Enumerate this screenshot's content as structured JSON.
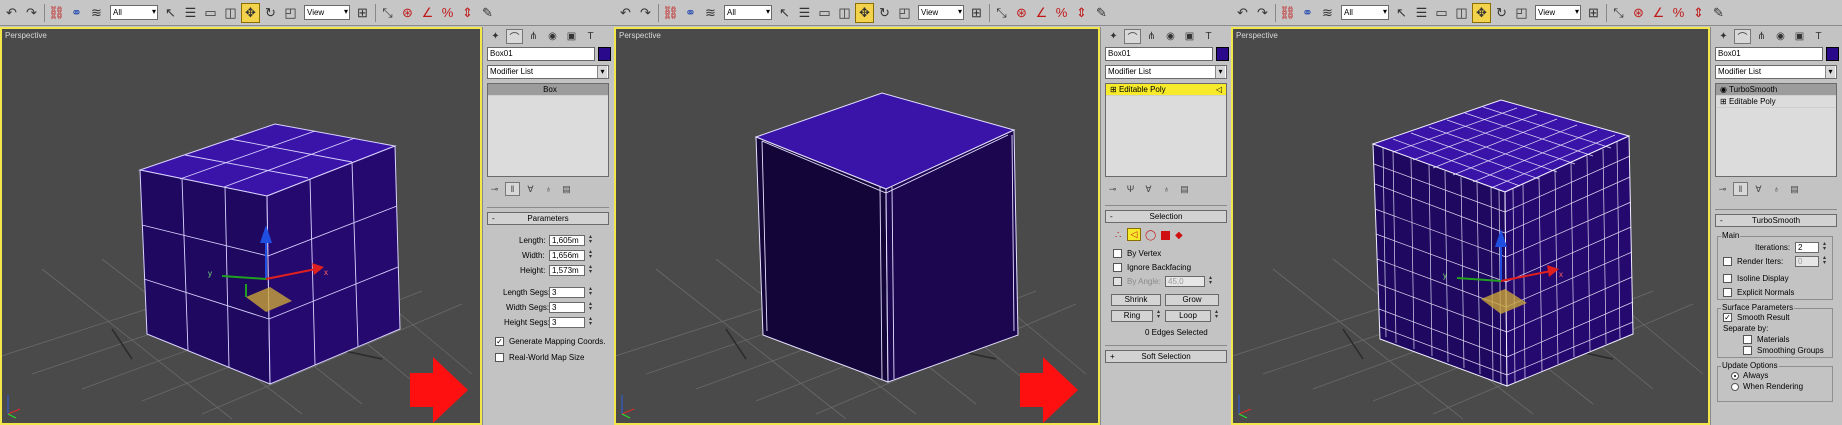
{
  "colors": {
    "viewport_border": "#f2e64a",
    "object_fill": "#2a0a8a",
    "arrow": "#ff1010",
    "stack_highlight": "#f6ea2a"
  },
  "panel1": {
    "viewport_label": "Perspective",
    "toolbar": {
      "selection_filter": "All",
      "coord_system": "View"
    },
    "object_name": "Box01",
    "modifier_list": "Modifier List",
    "stack": [
      "Box"
    ],
    "parameters": {
      "title": "Parameters",
      "length_label": "Length:",
      "length": "1,605m",
      "width_label": "Width:",
      "width": "1,656m",
      "height_label": "Height:",
      "height": "1,573m",
      "length_segs_label": "Length Segs:",
      "length_segs": "3",
      "width_segs_label": "Width Segs:",
      "width_segs": "3",
      "height_segs_label": "Height Segs:",
      "height_segs": "3",
      "gen_mapping": "Generate Mapping Coords.",
      "real_world": "Real-World Map Size"
    },
    "gizmo": {
      "x": "x",
      "y": "y"
    }
  },
  "panel2": {
    "viewport_label": "Perspective",
    "toolbar": {
      "selection_filter": "All",
      "coord_system": "View"
    },
    "object_name": "Box01",
    "modifier_list": "Modifier List",
    "stack": [
      "Editable Poly"
    ],
    "selection": {
      "title": "Selection",
      "by_vertex": "By Vertex",
      "ignore_backfacing": "Ignore Backfacing",
      "by_angle": "By Angle:",
      "angle_value": "45,0",
      "shrink": "Shrink",
      "grow": "Grow",
      "ring": "Ring",
      "loop": "Loop",
      "status": "0 Edges Selected"
    },
    "soft_selection": "Soft Selection"
  },
  "panel3": {
    "viewport_label": "Perspective",
    "toolbar": {
      "selection_filter": "All",
      "coord_system": "View"
    },
    "object_name": "Box01",
    "modifier_list": "Modifier List",
    "stack": [
      "TurboSmooth",
      "Editable Poly"
    ],
    "turbosmooth": {
      "title": "TurboSmooth",
      "main": "Main",
      "iterations_label": "Iterations:",
      "iterations": "2",
      "render_iters_label": "Render Iters:",
      "render_iters": "0",
      "isoline": "Isoline Display",
      "explicit_normals": "Explicit Normals",
      "surface_params": "Surface Parameters",
      "smooth_result": "Smooth Result",
      "separate_by": "Separate by:",
      "materials": "Materials",
      "smoothing_groups": "Smoothing Groups",
      "update_options": "Update Options",
      "always": "Always",
      "when_rendering": "When Rendering"
    },
    "gizmo": {
      "x": "x",
      "y": "y"
    }
  }
}
